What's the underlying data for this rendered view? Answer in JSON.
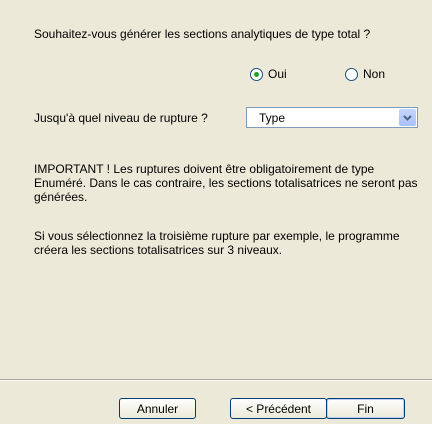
{
  "question": "Souhaitez-vous générer les sections analytiques de type total ?",
  "options": {
    "oui": "Oui",
    "non": "Non",
    "selected": "Oui"
  },
  "level": {
    "label": "Jusqu'à quel niveau de rupture ?",
    "value": "Type",
    "arrow_icon": "chevron-down-icon"
  },
  "important_text": "IMPORTANT ! Les ruptures doivent être obligatoirement de type Enuméré. Dans le cas contraire, les sections totalisatrices ne seront pas générées.",
  "info_text": "Si vous sélectionnez la troisième rupture par exemple, le programme créera les sections totalisatrices sur 3 niveaux.",
  "buttons": {
    "cancel": "Annuler",
    "previous": "< Précédent",
    "finish": "Fin"
  },
  "colors": {
    "dialog_bg": "#ece9d8",
    "radio_dot": "#21a121",
    "button_border": "#003c74"
  }
}
